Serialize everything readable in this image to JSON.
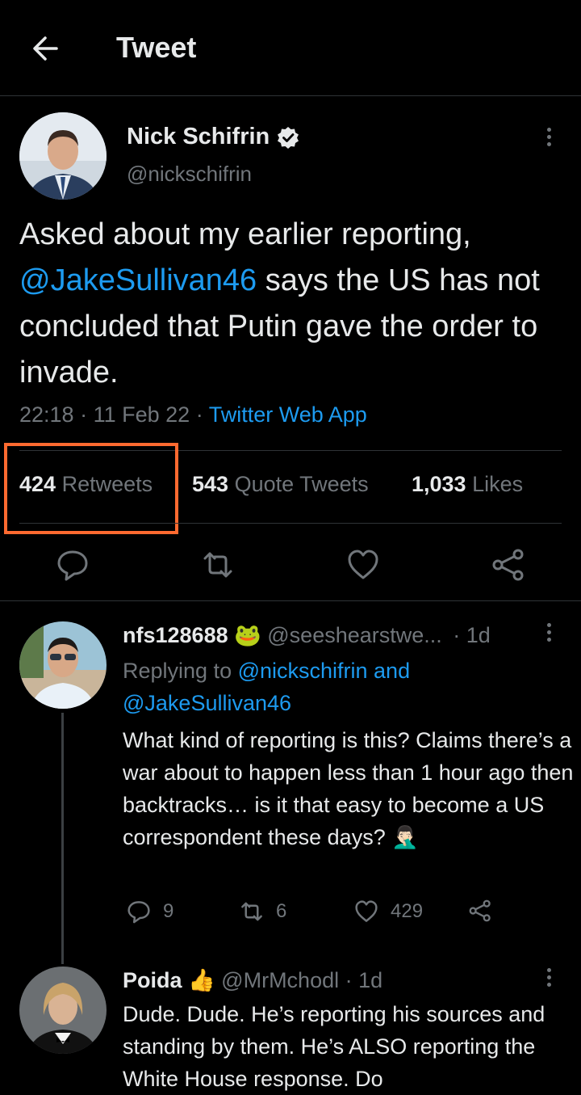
{
  "header": {
    "title": "Tweet"
  },
  "tweet": {
    "author_name": "Nick Schifrin",
    "handle": "@nickschifrin",
    "text_before": "Asked about my earlier reporting, ",
    "mention": "@JakeSullivan46",
    "text_after": " says the US has not concluded that Putin gave the order to invade.",
    "time": "22:18",
    "date": "11 Feb 22",
    "sep": "·",
    "app": "Twitter Web App",
    "stats": {
      "retweets_count": "424",
      "retweets_label": "Retweets",
      "quotes_count": "543",
      "quotes_label": "Quote Tweets",
      "likes_count": "1,033",
      "likes_label": "Likes"
    }
  },
  "replies": [
    {
      "name": "nfs128688",
      "emoji": "🐸",
      "handle": "@seeshearstwe...",
      "time": "· 1d",
      "replying_label": "Replying to ",
      "replying_to": "@nickschifrin and @JakeSullivan46",
      "text": "What kind of reporting is this? Claims there’s a war about to happen less than 1 hour ago then backtracks… is it that easy to become a US correspondent these days? 🤦🏻‍♂️",
      "replies_count": "9",
      "retweets_count": "6",
      "likes_count": "429"
    },
    {
      "name": "Poida",
      "emoji": "👍",
      "handle": "@MrMchodl",
      "time": "· 1d",
      "text": "Dude. Dude. He’s reporting his sources and standing by them. He’s ALSO reporting the White House response. Do"
    }
  ],
  "colors": {
    "accent": "#1d9bf0",
    "highlight": "#ff6a30",
    "muted": "#71767b"
  }
}
